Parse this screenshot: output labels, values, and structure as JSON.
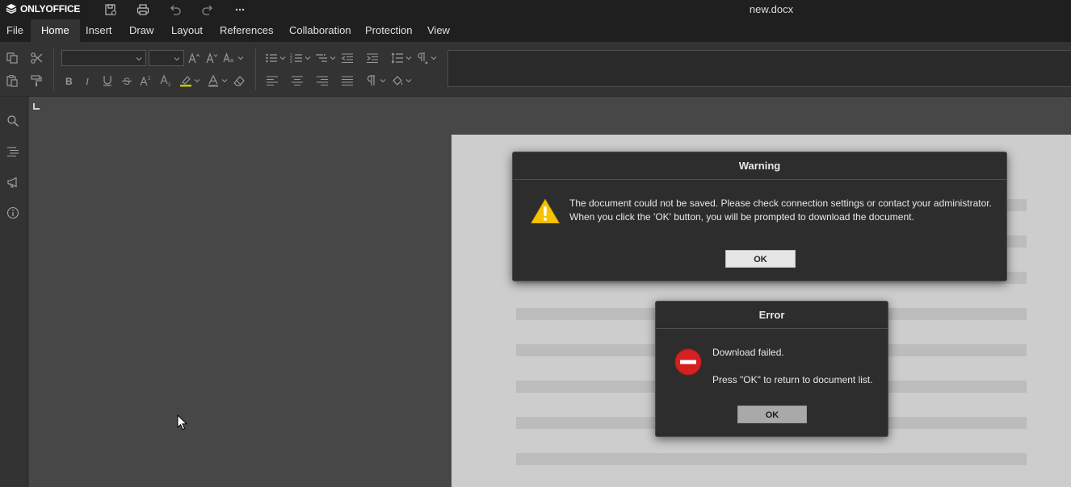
{
  "app": {
    "brand": "ONLYOFFICE",
    "doc_title": "new.docx"
  },
  "menu": {
    "tabs": [
      {
        "label": "File"
      },
      {
        "label": "Home"
      },
      {
        "label": "Insert"
      },
      {
        "label": "Draw"
      },
      {
        "label": "Layout"
      },
      {
        "label": "References"
      },
      {
        "label": "Collaboration"
      },
      {
        "label": "Protection"
      },
      {
        "label": "View"
      }
    ],
    "active": "Home"
  },
  "toolbar": {
    "font_name": "",
    "font_size": ""
  },
  "warning_dialog": {
    "title": "Warning",
    "icon": "warning-triangle-icon",
    "line1": "The document could not be saved. Please check connection settings or contact your administrator.",
    "line2": "When you click the 'OK' button, you will be prompted to download the document.",
    "ok_label": "OK"
  },
  "error_dialog": {
    "title": "Error",
    "icon": "error-stop-icon",
    "line1": "Download failed.",
    "line2": "Press \"OK\" to return to document list.",
    "ok_label": "OK"
  },
  "colors": {
    "titlebar": "#1f1f1f",
    "toolbar": "#333333",
    "canvas": "#474747",
    "warning_yellow": "#f5c400",
    "error_red": "#d32020"
  }
}
